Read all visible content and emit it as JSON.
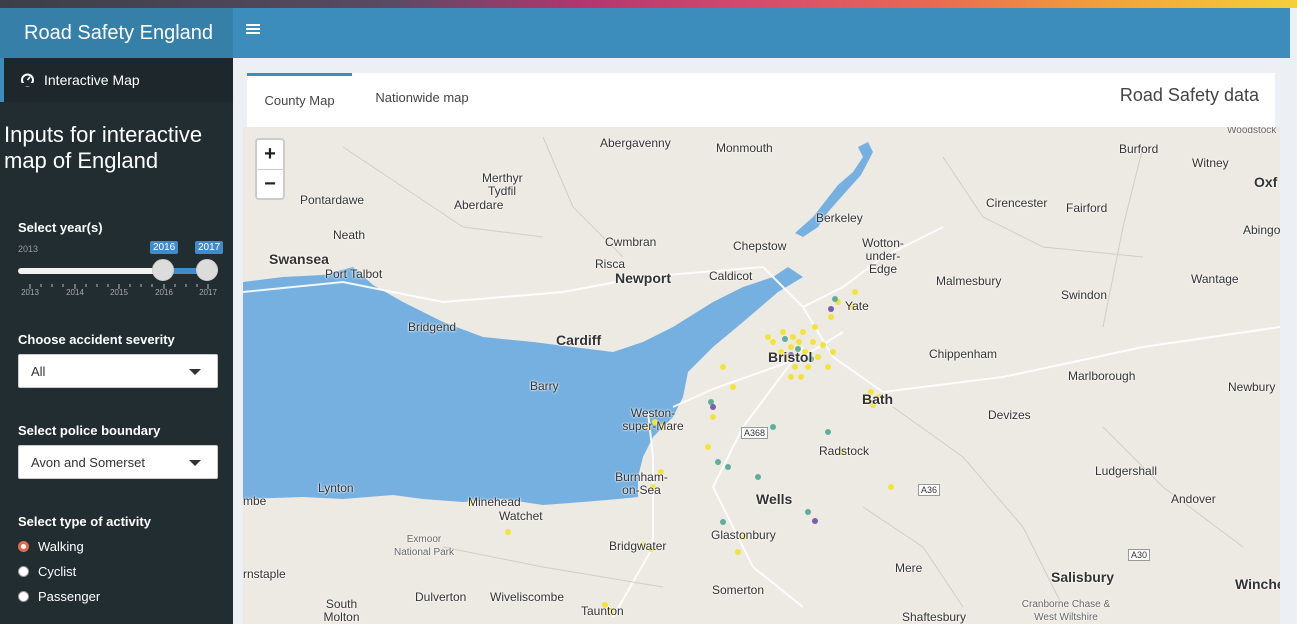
{
  "app": {
    "title": "Road Safety England"
  },
  "sidebar": {
    "menu_item": "Interactive Map",
    "inputs_title": "Inputs for interactive map of England",
    "year": {
      "label": "Select year(s)",
      "min": "2013",
      "from": "2016",
      "to": "2017",
      "ticks": [
        "2013",
        "2014",
        "2015",
        "2016",
        "2017"
      ],
      "range_fraction": [
        0.75,
        1.0
      ]
    },
    "severity": {
      "label": "Choose accident severity",
      "value": "All"
    },
    "police": {
      "label": "Select police boundary",
      "value": "Avon and Somerset"
    },
    "activity": {
      "label": "Select type of activity",
      "options": [
        "Walking",
        "Cyclist",
        "Passenger"
      ],
      "selected": "Walking"
    }
  },
  "tabs": [
    "County Map",
    "Nationwide map"
  ],
  "box_title": "Road Safety data",
  "map": {
    "zoom_in": "+",
    "zoom_out": "−",
    "places": [
      "Abergavenny",
      "Monmouth",
      "Burford",
      "Witney",
      "Oxf",
      "Woodstock",
      "Merthyr Tydfil",
      "Pontardawe",
      "Aberdare",
      "Berkeley",
      "Cirencester",
      "Fairford",
      "Abingo",
      "Neath",
      "Cwmbran",
      "Chepstow",
      "Wotton-under-Edge",
      "Swansea",
      "Port Talbot",
      "Risca",
      "Caldicot",
      "Newport",
      "Malmesbury",
      "Swindon",
      "Wantage",
      "Yate",
      "Bridgend",
      "Cardiff",
      "Bristol",
      "Chippenham",
      "Marlborough",
      "Newbury",
      "Barry",
      "Bath",
      "Devizes",
      "Weston-super-Mare",
      "Radstock",
      "Ludgershall",
      "Lynton",
      "Minehead",
      "Watchet",
      "Burnham-on-Sea",
      "Wells",
      "Andover",
      "Exmoor National Park",
      "Bridgwater",
      "Glastonbury",
      "rnstaple",
      "Mere",
      "Salisbury",
      "Winchest",
      "South Molton",
      "Dulverton",
      "Wiveliscombe",
      "Taunton",
      "Somerton",
      "Shaftesbury",
      "Cranborne Chase & West Wiltshire",
      "mbe"
    ],
    "roads": [
      "A368",
      "A36",
      "A30"
    ],
    "colors": {
      "water": "#75b0e0",
      "land": "#ede9e3",
      "accident_yellow": "#f2e33a",
      "accident_teal": "#5fae9b",
      "accident_purple": "#7b5fa5"
    }
  },
  "colors": {
    "header": "#3c8dbc",
    "brand": "#367fa9",
    "sidebar": "#222d32",
    "slider": "#428bca"
  }
}
